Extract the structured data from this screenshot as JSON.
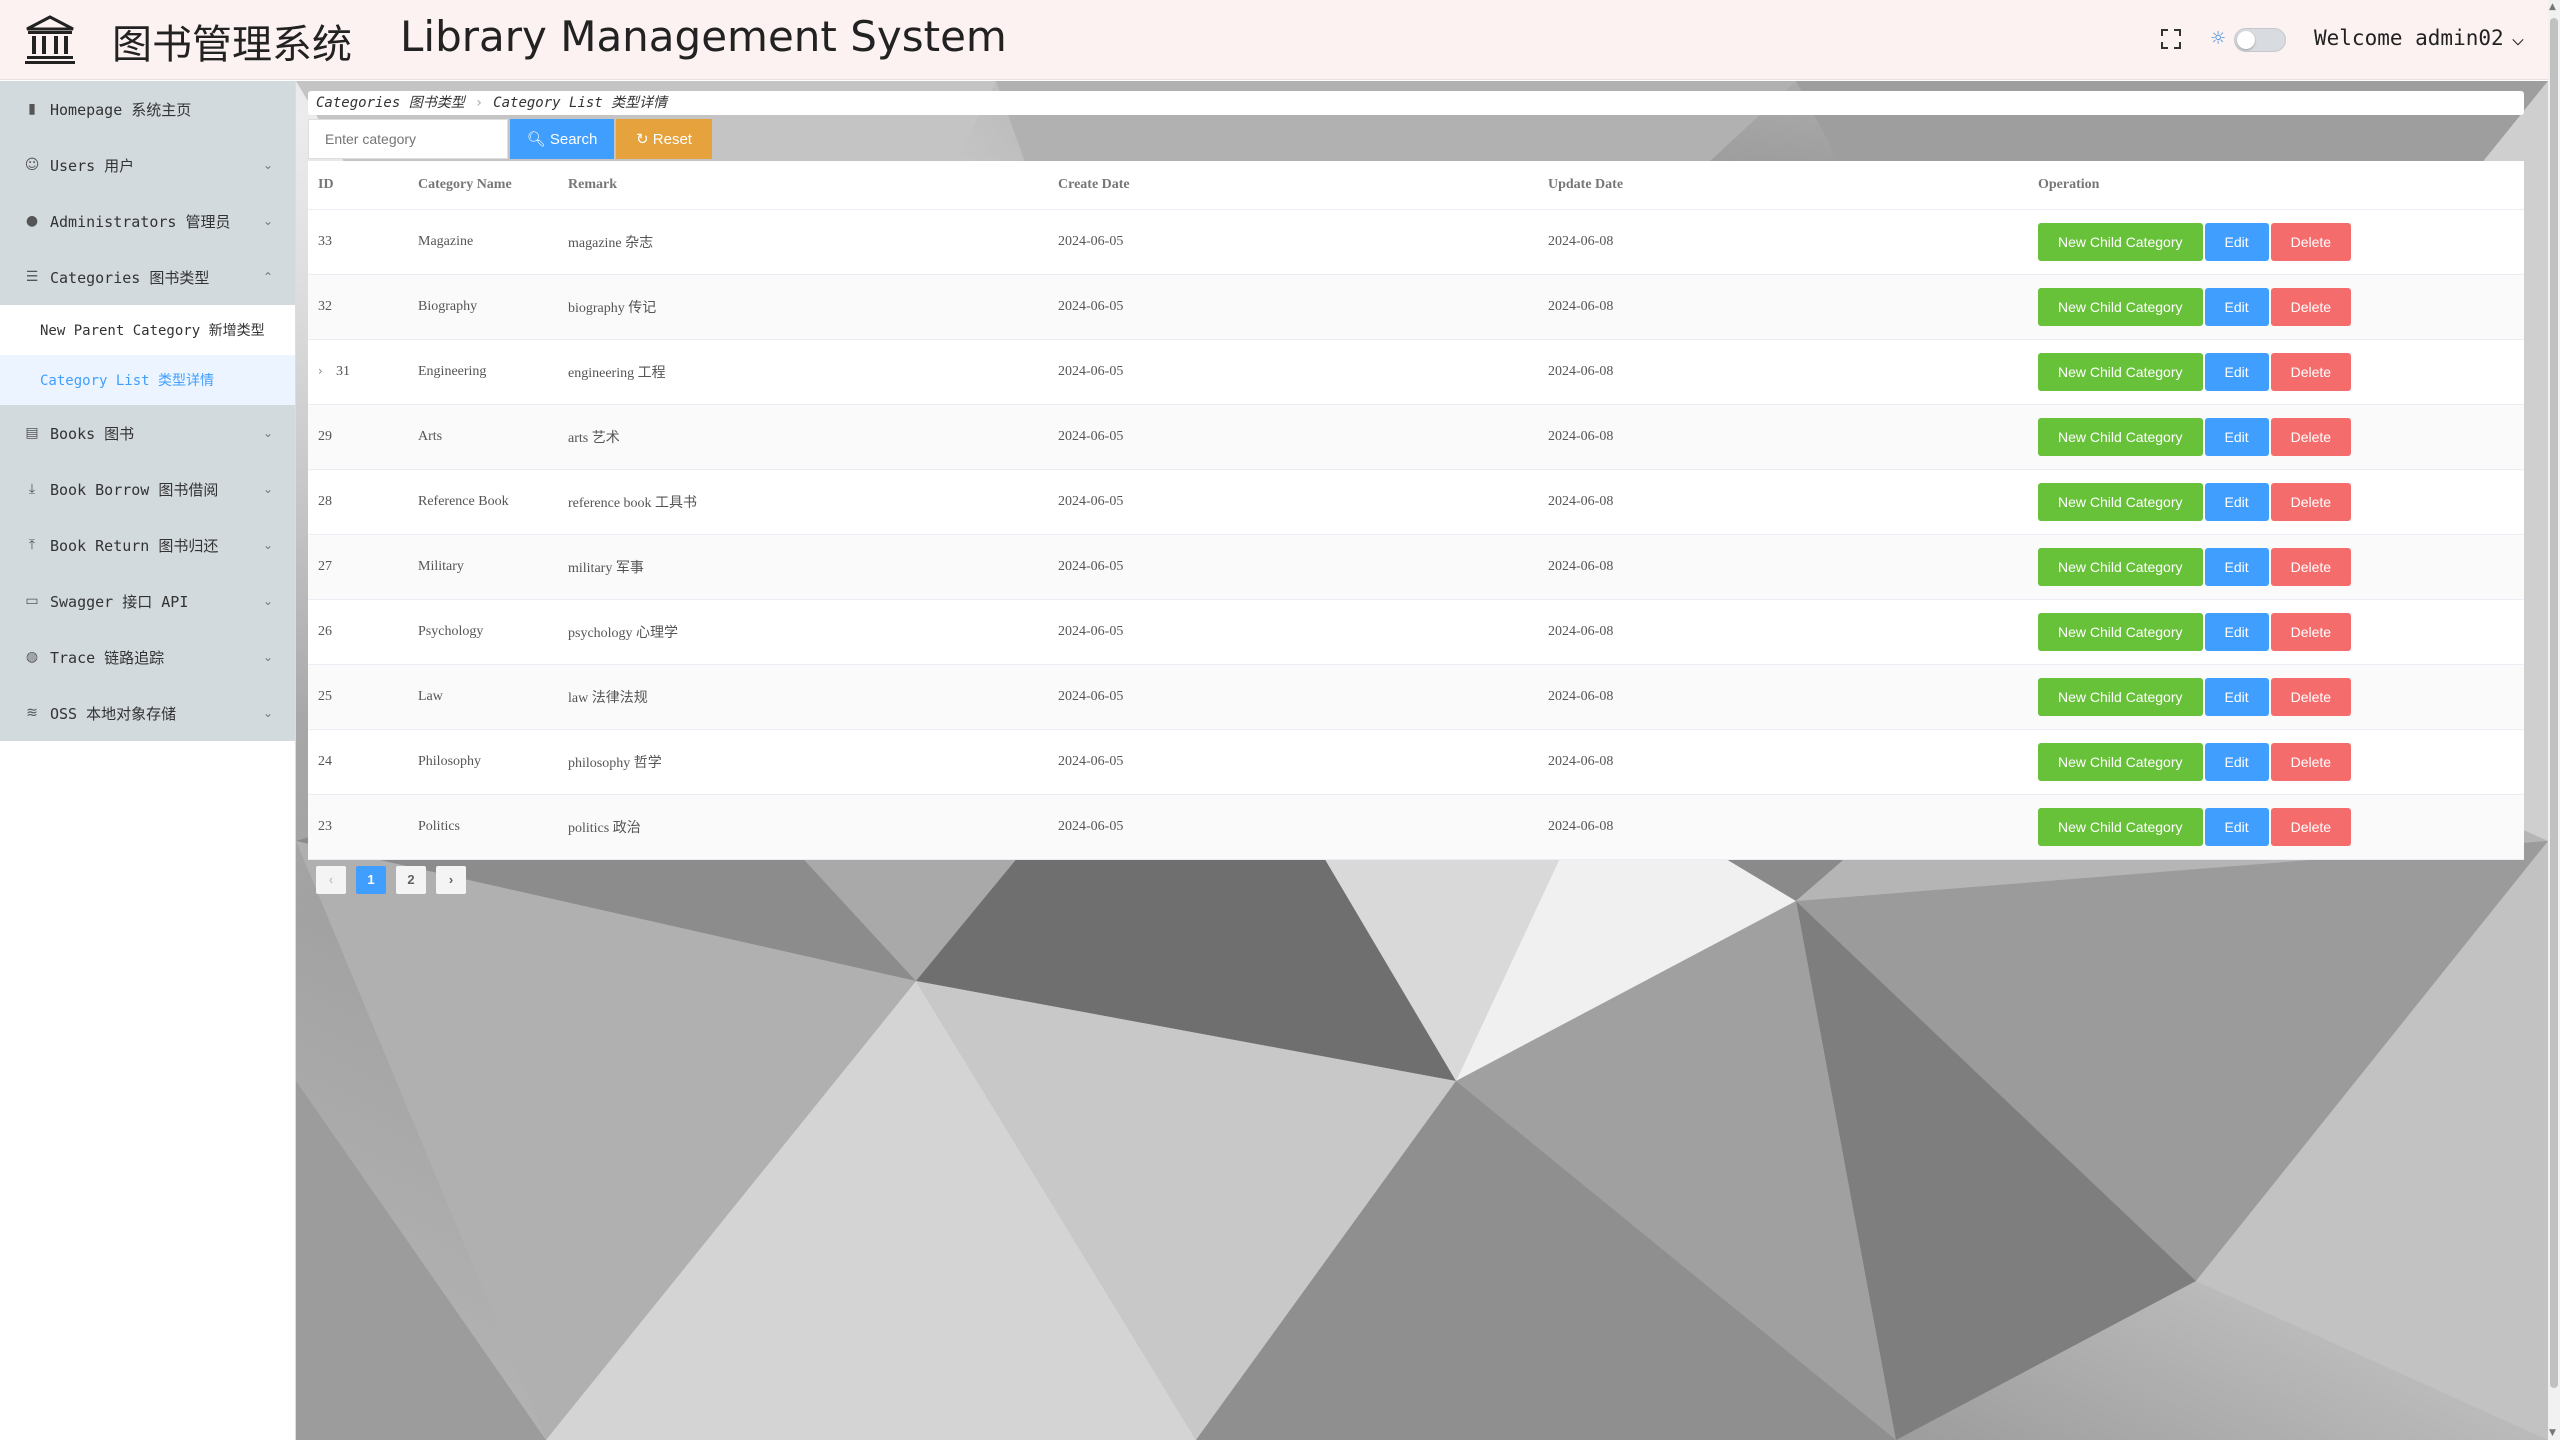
{
  "header": {
    "title_cn": "图书管理系统",
    "title_en": "Library Management System",
    "welcome": "Welcome admin02"
  },
  "sidebar": {
    "items": [
      {
        "label": "Homepage 系统主页",
        "icon": "bar-chart-icon",
        "arrow": ""
      },
      {
        "label": "Users 用户",
        "icon": "user-icon",
        "arrow": "⌄"
      },
      {
        "label": "Administrators 管理员",
        "icon": "admin-icon",
        "arrow": "⌄"
      },
      {
        "label": "Categories 图书类型",
        "icon": "menu-icon",
        "arrow": "⌃"
      },
      {
        "label": "Books 图书",
        "icon": "book-icon",
        "arrow": "⌄"
      },
      {
        "label": "Book Borrow 图书借阅",
        "icon": "download-icon",
        "arrow": "⌄"
      },
      {
        "label": "Book Return 图书归还",
        "icon": "upload-icon",
        "arrow": "⌄"
      },
      {
        "label": "Swagger 接口 API",
        "icon": "folder-icon",
        "arrow": "⌄"
      },
      {
        "label": "Trace 链路追踪",
        "icon": "globe-icon",
        "arrow": "⌄"
      },
      {
        "label": "OSS 本地对象存储",
        "icon": "database-icon",
        "arrow": "⌄"
      }
    ],
    "sub_items": [
      {
        "label": "New Parent Category 新增类型",
        "active": false
      },
      {
        "label": "Category List 类型详情",
        "active": true
      }
    ]
  },
  "breadcrumb": {
    "level1": "Categories 图书类型",
    "level2": "Category List 类型详情"
  },
  "search": {
    "placeholder": "Enter category",
    "search_label": "Search",
    "reset_label": "Reset"
  },
  "table": {
    "columns": [
      "ID",
      "Category Name",
      "Remark",
      "Create Date",
      "Update Date",
      "Operation"
    ],
    "rows": [
      {
        "id": "33",
        "name": "Magazine",
        "remark": "magazine 杂志",
        "create": "2024-06-05",
        "update": "2024-06-08",
        "expand": false
      },
      {
        "id": "32",
        "name": "Biography",
        "remark": "biography 传记",
        "create": "2024-06-05",
        "update": "2024-06-08",
        "expand": false
      },
      {
        "id": "31",
        "name": "Engineering",
        "remark": "engineering 工程",
        "create": "2024-06-05",
        "update": "2024-06-08",
        "expand": true
      },
      {
        "id": "29",
        "name": "Arts",
        "remark": "arts 艺术",
        "create": "2024-06-05",
        "update": "2024-06-08",
        "expand": false
      },
      {
        "id": "28",
        "name": "Reference Book",
        "remark": "reference book 工具书",
        "create": "2024-06-05",
        "update": "2024-06-08",
        "expand": false
      },
      {
        "id": "27",
        "name": "Military",
        "remark": "military 军事",
        "create": "2024-06-05",
        "update": "2024-06-08",
        "expand": false
      },
      {
        "id": "26",
        "name": "Psychology",
        "remark": "psychology 心理学",
        "create": "2024-06-05",
        "update": "2024-06-08",
        "expand": false
      },
      {
        "id": "25",
        "name": "Law",
        "remark": "law 法律法规",
        "create": "2024-06-05",
        "update": "2024-06-08",
        "expand": false
      },
      {
        "id": "24",
        "name": "Philosophy",
        "remark": "philosophy 哲学",
        "create": "2024-06-05",
        "update": "2024-06-08",
        "expand": false
      },
      {
        "id": "23",
        "name": "Politics",
        "remark": "politics 政治",
        "create": "2024-06-05",
        "update": "2024-06-08",
        "expand": false
      }
    ],
    "ops": {
      "child": "New Child Category",
      "edit": "Edit",
      "delete": "Delete"
    }
  },
  "pagination": {
    "prev": "‹",
    "pages": [
      "1",
      "2"
    ],
    "current": "1",
    "next": "›"
  },
  "colors": {
    "primary": "#409eff",
    "success": "#67c23a",
    "warning": "#e6a23c",
    "danger": "#f56c6c"
  }
}
